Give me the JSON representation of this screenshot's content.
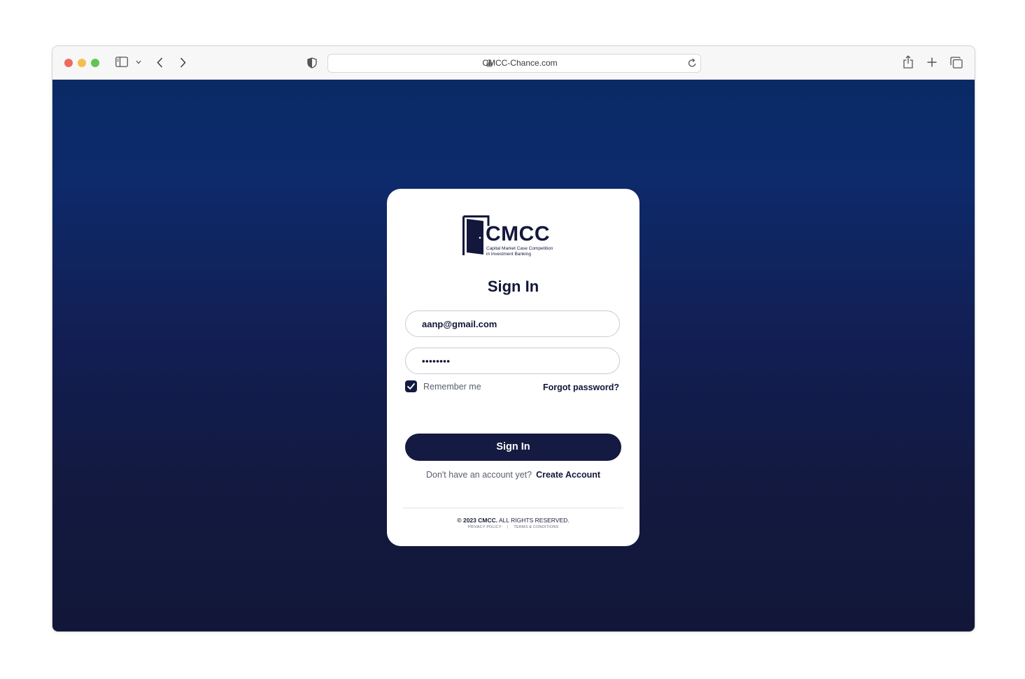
{
  "browser": {
    "url": "CMCC-Chance.com"
  },
  "brand": {
    "wordmark": "CMCC",
    "tagline_line1": "Capital Market Case Competition",
    "tagline_line2": "in Investment Banking"
  },
  "form": {
    "title": "Sign In",
    "email_value": "aanp@gmail.com",
    "password_mask": "••••••••",
    "remember_label": "Remember me",
    "remember_checked": true,
    "forgot_label": "Forgot password?",
    "submit_label": "Sign In",
    "signup_prompt": "Don't have an account yet?",
    "signup_link": "Create Account"
  },
  "footer": {
    "copyright_prefix": "© 2023 CMCC.",
    "copyright_suffix": "ALL RIGHTS RESERVED.",
    "privacy": "PRIVACY POLICY",
    "terms": "TERMS & CONDITIONS"
  },
  "colors": {
    "navy": "#151a42",
    "background_top": "#0a2a66",
    "background_bottom": "#121739"
  }
}
